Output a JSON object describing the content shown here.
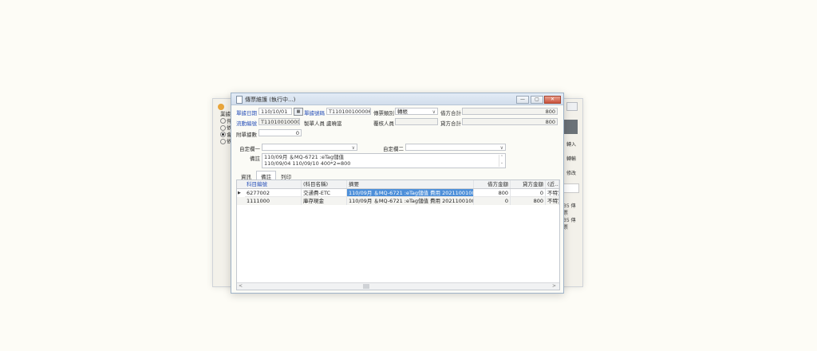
{
  "background_window": {
    "left_label": "業據",
    "radio_options": [
      "件",
      "依",
      "會",
      "依"
    ],
    "right_buttons": [
      "轉入",
      "轉輸",
      "修改"
    ],
    "right_text": [
      "35 傳票",
      "35 傳票"
    ]
  },
  "window": {
    "title": "傳票維護 (執行中...)",
    "buttons": {
      "minimize": "—",
      "maximize": "▢",
      "close": "✕"
    }
  },
  "form": {
    "voucher_date_label": "單據日期",
    "voucher_date_value": "110/10/01",
    "voucher_no_label": "單據號碼",
    "voucher_no_value": "T110100100006",
    "voucher_type_label": "傳票類別",
    "voucher_type_value": "轉帳",
    "debit_total_label": "借方合計",
    "debit_total_value": "800",
    "flow_no_label": "流動編號",
    "flow_no_value": "T110100100005",
    "creator_label": "製單人員",
    "creator_value": "盧曉當",
    "reviewer_label": "覆核人員",
    "reviewer_value": "",
    "credit_total_label": "貸方合計",
    "credit_total_value": "800",
    "attachments_label": "附單據數",
    "attachments_value": "0",
    "custom1_label": "自定欄一",
    "custom1_value": "",
    "custom2_label": "自定欄二",
    "custom2_value": "",
    "notes_label": "備註",
    "notes_lines": [
      "110/09月 ＆MQ-6721 :eTag儲值",
      "110/09/04 110/09/10 400*2=800"
    ]
  },
  "tabs": [
    {
      "label": "資訊"
    },
    {
      "label": "備註"
    },
    {
      "label": "列印"
    }
  ],
  "grid": {
    "headers": [
      "科目編號",
      "(科目名稱)",
      "摘要",
      "借方金額",
      "貸方金額",
      "(近..."
    ],
    "rows": [
      [
        "6277002",
        "交通費-ETC",
        "110/09月 ＆MQ-6721 :eTag儲值 費用 20211001005 (傳票 etag",
        "800",
        "0",
        "不特別"
      ],
      [
        "1111000",
        "庫存現金",
        "110/09月 ＆MQ-6721 :eTag儲值 費用 20211001005 (傳...",
        "0",
        "800",
        "不特別"
      ]
    ]
  }
}
